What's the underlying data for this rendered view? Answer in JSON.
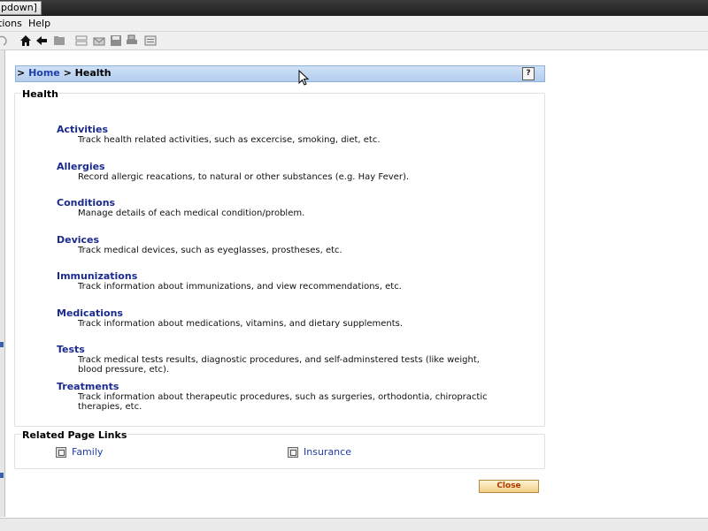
{
  "window": {
    "title": "pdown]"
  },
  "menu": {
    "items": [
      "tions",
      "Help"
    ]
  },
  "toolbar": {
    "icons": [
      "undo-icon",
      "home-icon",
      "back-arrow-icon",
      "folder-icon",
      "edit-icon",
      "email-icon",
      "save-icon",
      "print-icon",
      "document-icon"
    ]
  },
  "breadcrumb": {
    "sep1": ">",
    "home": "Home",
    "sep2": ">",
    "current": "Health",
    "help": "?"
  },
  "section": {
    "title": "Health",
    "items": [
      {
        "name": "Activities",
        "description": "Track health related activities, such as excercise, smoking, diet, etc."
      },
      {
        "name": "Allergies",
        "description": "Record allergic reacations, to natural or other substances (e.g. Hay Fever)."
      },
      {
        "name": "Conditions",
        "description": "Manage details of each medical condition/problem."
      },
      {
        "name": "Devices",
        "description": "Track medical devices, such as eyeglasses, prostheses, etc."
      },
      {
        "name": "Immunizations",
        "description": "Track information about immunizations, and view recommendations, etc."
      },
      {
        "name": "Medications",
        "description": "Track information about medications, vitamins, and dietary supplements."
      },
      {
        "name": "Tests",
        "description": "Track medical tests results, diagnostic procedures, and self-adminstered tests (like weight, blood pressure, etc)."
      },
      {
        "name": "Treatments",
        "description": "Track information about therapeutic procedures, such as surgeries, orthodontia, chiropractic therapies, etc."
      }
    ]
  },
  "related": {
    "title": "Related Page Links",
    "links": [
      "Family",
      "Insurance"
    ]
  },
  "buttons": {
    "close": "Close"
  },
  "colors": {
    "link": "#1b2a8f",
    "breadcrumb_bg": "#c4d8f3",
    "close_text": "#b23a00"
  }
}
